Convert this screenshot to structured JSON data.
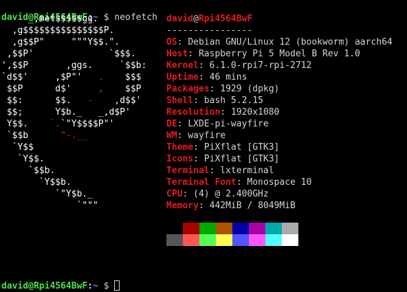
{
  "prompt": {
    "user_host": "david@Rpi4564BwF",
    "separator": ":",
    "path": "~",
    "symbol": "$",
    "command": "neofetch"
  },
  "logo_lines": [
    {
      "white": "     _,met$$$$$gg.",
      "red": ""
    },
    {
      "white": "  ,g$$$$$$$$$$$$$$$P.",
      "red": ""
    },
    {
      "white": "  ,g$$P\"     \"\"\"Y$$.\".",
      "red": ""
    },
    {
      "white": " ,$$P'              `$$$.",
      "red": ""
    },
    {
      "white": "',$$P       ,ggs.     `$$b:",
      "red": ""
    },
    {
      "white": "`d$$'     ,$P\"'   ",
      "red": ".",
      "white2": "    $$$"
    },
    {
      "white": " $$P      d$'     ",
      "red": ",",
      "white2": "    $$P"
    },
    {
      "white": " $$:      $$.   ",
      "red": "-",
      "white2": "    ,d$$'"
    },
    {
      "white": " $$;      Y$b._   _,d$P'",
      "red": ""
    },
    {
      "white": " Y$$.    ",
      "red": "`.",
      "white2": "`\"Y$$$$P\"'"
    },
    {
      "white": " `$$b      ",
      "red": "\"-.__",
      "white2": ""
    },
    {
      "white": "  `Y$$",
      "red": ""
    },
    {
      "white": "   `Y$$.",
      "red": ""
    },
    {
      "white": "     `$$b.",
      "red": ""
    },
    {
      "white": "       `Y$$b.",
      "red": ""
    },
    {
      "white": "          `\"Y$b._",
      "red": ""
    },
    {
      "white": "              `\"\"\"",
      "red": ""
    }
  ],
  "info": {
    "user": "david",
    "at": "@",
    "host": "Rpi4564BwF",
    "dashes": "----------------",
    "fields": [
      {
        "key": "OS",
        "value": "Debian GNU/Linux 12 (bookworm) aarch64"
      },
      {
        "key": "Host",
        "value": "Raspberry Pi 5 Model B Rev 1.0"
      },
      {
        "key": "Kernel",
        "value": "6.1.0-rpi7-rpi-2712"
      },
      {
        "key": "Uptime",
        "value": "46 mins"
      },
      {
        "key": "Packages",
        "value": "1929 (dpkg)"
      },
      {
        "key": "Shell",
        "value": "bash 5.2.15"
      },
      {
        "key": "Resolution",
        "value": "1920x1080"
      },
      {
        "key": "DE",
        "value": "LXDE-pi-wayfire"
      },
      {
        "key": "WM",
        "value": "wayfire"
      },
      {
        "key": "Theme",
        "value": "PiXflat [GTK3]"
      },
      {
        "key": "Icons",
        "value": "PiXflat [GTK3]"
      },
      {
        "key": "Terminal",
        "value": "lxterminal"
      },
      {
        "key": "Terminal Font",
        "value": "Monospace 10"
      },
      {
        "key": "CPU",
        "value": "(4) @ 2.400GHz"
      },
      {
        "key": "Memory",
        "value": "442MiB / 8049MiB"
      }
    ]
  },
  "palette": {
    "normal": [
      "#000000",
      "#aa0000",
      "#00aa00",
      "#aa5500",
      "#0000aa",
      "#aa00aa",
      "#00aaaa",
      "#aaaaaa"
    ],
    "bright": [
      "#555555",
      "#ff5555",
      "#55ff55",
      "#ffff55",
      "#5555ff",
      "#ff55ff",
      "#55ffff",
      "#ffffff"
    ]
  },
  "colors": {
    "background": "#000000",
    "user_green": "#4ce04c",
    "path_blue": "#5a8ef0",
    "accent_red": "#e01b24",
    "text": "#d3d7cf"
  }
}
